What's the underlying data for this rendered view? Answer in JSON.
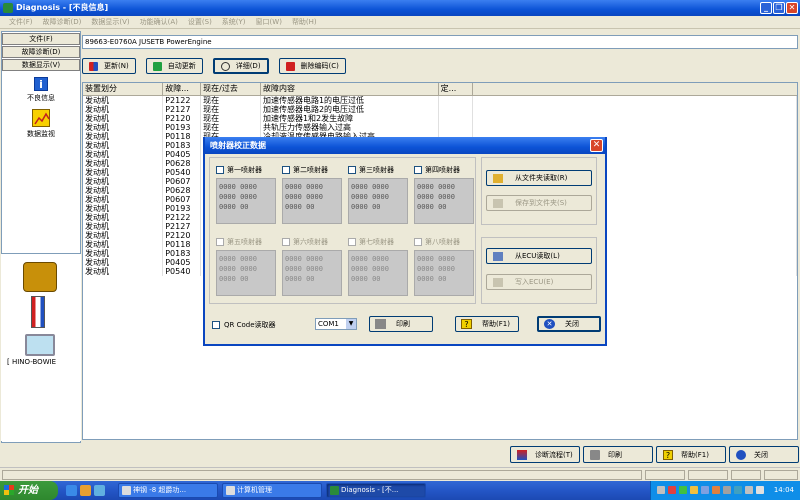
{
  "window": {
    "title": "Diagnosis - [不良信息]",
    "controls": [
      "_",
      "❐",
      "✕"
    ]
  },
  "menubar": [
    "文件(F)",
    "故障诊断(D)",
    "数据显示(V)",
    "功能确认(A)",
    "设置(S)",
    "系统(Y)",
    "窗口(W)",
    "帮助(H)"
  ],
  "sidebar": {
    "nav": [
      "文件(F)",
      "故障诊断(D)",
      "数据显示(V)"
    ],
    "items": [
      {
        "label": "不良信息",
        "icon": "info-icon"
      },
      {
        "label": "数据监视",
        "icon": "data-monitor-icon"
      }
    ],
    "model_label": "[ HINO-BOWIE"
  },
  "vin": "89663-E0760A JUSETB PowerEngine",
  "toolbar": {
    "update": "更新(N)",
    "auto_update": "自动更新",
    "detail": "详细(D)",
    "delete_code": "删除编码(C)"
  },
  "table": {
    "headers": [
      "装置划分",
      "故障...",
      "现在/过去",
      "故障内容",
      "定..."
    ],
    "rows": [
      [
        "发动机",
        "P2122",
        "现在",
        "加速传感器电路1的电压过低"
      ],
      [
        "发动机",
        "P2127",
        "现在",
        "加速传感器电路2的电压过低"
      ],
      [
        "发动机",
        "P2120",
        "现在",
        "加速传感器1和2发生故障"
      ],
      [
        "发动机",
        "P0193",
        "现在",
        "共轨压力传感器输入过高"
      ],
      [
        "发动机",
        "P0118",
        "现在",
        "冷却液温度传感器电路输入过高"
      ],
      [
        "发动机",
        "P0183",
        "",
        ""
      ],
      [
        "发动机",
        "P0405",
        "",
        ""
      ],
      [
        "发动机",
        "P0628",
        "",
        ""
      ],
      [
        "发动机",
        "P0540",
        "",
        ""
      ],
      [
        "发动机",
        "P0607",
        "",
        ""
      ],
      [
        "发动机",
        "P0628",
        "",
        ""
      ],
      [
        "发动机",
        "P0607",
        "",
        ""
      ],
      [
        "发动机",
        "P0193",
        "",
        ""
      ],
      [
        "发动机",
        "P2122",
        "",
        ""
      ],
      [
        "发动机",
        "P2127",
        "",
        ""
      ],
      [
        "发动机",
        "P2120",
        "",
        ""
      ],
      [
        "发动机",
        "P0118",
        "",
        ""
      ],
      [
        "发动机",
        "P0183",
        "",
        ""
      ],
      [
        "发动机",
        "P0405",
        "",
        ""
      ],
      [
        "发动机",
        "P0540",
        "",
        ""
      ]
    ]
  },
  "bottom_buttons": {
    "flow": "诊断流程(T)",
    "print": "印刷",
    "help": "帮助(F1)",
    "close": "关闭"
  },
  "dialog": {
    "title": "喷射器校正数据",
    "injectors": [
      {
        "label": "第一喷射器",
        "value": "0000 0000\n0000 0000\n0000 00",
        "enabled": true
      },
      {
        "label": "第二喷射器",
        "value": "0000 0000\n0000 0000\n0000 00",
        "enabled": true
      },
      {
        "label": "第三喷射器",
        "value": "0000 0000\n0000 0000\n0000 00",
        "enabled": true
      },
      {
        "label": "第四喷射器",
        "value": "0000 0000\n0000 0000\n0000 00",
        "enabled": true
      },
      {
        "label": "第五喷射器",
        "value": "0000 0000\n0000 0000\n0000 00",
        "enabled": false
      },
      {
        "label": "第六喷射器",
        "value": "0000 0000\n0000 0000\n0000 00",
        "enabled": false
      },
      {
        "label": "第七喷射器",
        "value": "0000 0000\n0000 0000\n0000 00",
        "enabled": false
      },
      {
        "label": "第八喷射器",
        "value": "0000 0000\n0000 0000\n0000 00",
        "enabled": false
      }
    ],
    "read_file": "从文件夹读取(R)",
    "save_file": "保存到文件夹(S)",
    "read_ecu": "从ECU读取(L)",
    "write_ecu": "写入ECU(E)",
    "qr_label": "QR Code读取器",
    "com_value": "COM1",
    "print": "印刷",
    "help": "帮助(F1)",
    "close": "关闭"
  },
  "taskbar": {
    "start": "开始",
    "tasks": [
      "神钢 -8  超爵功...",
      "计算机管理",
      "Diagnosis - [不..."
    ],
    "clock": "14:04"
  }
}
